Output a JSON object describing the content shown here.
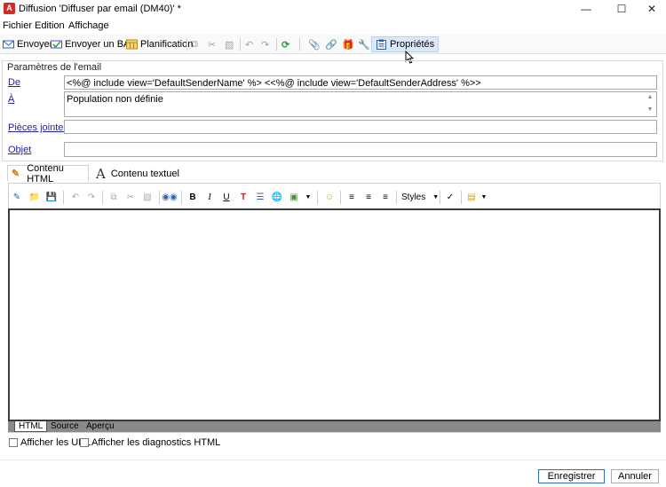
{
  "window": {
    "app_icon": "acrobat-style-red-icon",
    "title": "Diffusion 'Diffuser par email (DM40)' *",
    "controls": [
      "minimize-icon",
      "maximize-icon",
      "close-icon"
    ]
  },
  "menu": [
    "Fichier",
    "Edition",
    "Affichage"
  ],
  "toolbar": {
    "send": "Envoyer",
    "send_bat": "Envoyer un BAT",
    "planning": "Planification",
    "properties": "Propriétés"
  },
  "email_params": {
    "group_title": "Paramètres de l'email",
    "from_label": "De",
    "from_value": "<%@ include view='DefaultSenderName' %> <<%@ include view='DefaultSenderAddress' %>>",
    "to_label": "À",
    "to_value": "Population non définie",
    "attachments_label": "Pièces jointes",
    "attachments_value": "",
    "subject_label": "Objet",
    "subject_value": ""
  },
  "content_tabs": {
    "html": "Contenu HTML",
    "text": "Contenu textuel",
    "selected": "html"
  },
  "editor": {
    "styles_label": "Styles",
    "bottom_tabs": [
      "HTML",
      "Source",
      "Aperçu"
    ],
    "selected_bottom_tab": "HTML",
    "show_urls": "Afficher les URL",
    "show_diagnostics": "Afficher les diagnostics HTML",
    "show_urls_checked": false,
    "show_diagnostics_checked": false
  },
  "footer": {
    "save": "Enregistrer",
    "cancel": "Annuler"
  },
  "colors": {
    "app_icon_red": "#d12b2b",
    "link_blue": "#2222aa",
    "active_button_bg": "#dbe8f7",
    "primary_button_border": "#2f6fc0"
  }
}
